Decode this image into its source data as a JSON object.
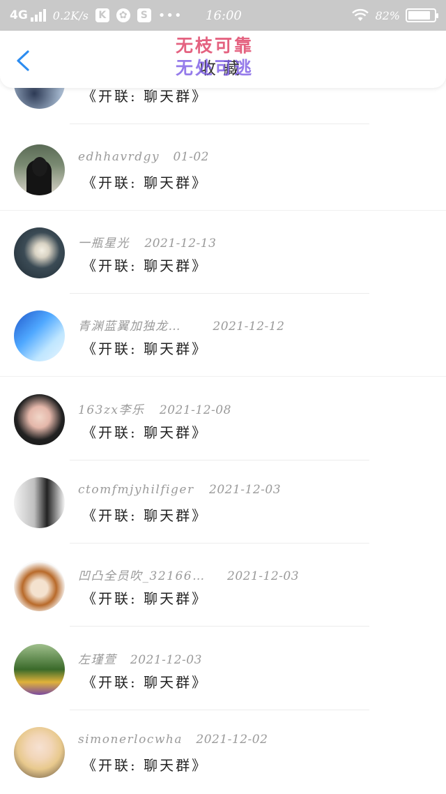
{
  "status_bar": {
    "network": "4G",
    "speed": "0.2K/s",
    "app_icon_1": "K",
    "app_icon_2": "S",
    "more": "•••",
    "time": "16:00",
    "battery_text": "82%",
    "battery_level": 0.82
  },
  "header": {
    "title": "收藏",
    "watermark_line1": "无枝可靠",
    "watermark_line2": "无处可逃"
  },
  "items": [
    {
      "name": "",
      "date": "",
      "message": "《开联: 聊天群》"
    },
    {
      "name": "edhhavrdgy",
      "date": "01-02",
      "message": "《开联: 聊天群》"
    },
    {
      "name": "一瓶星光",
      "date": "2021-12-13",
      "message": "《开联: 聊天群》"
    },
    {
      "name": "青渊蓝翼加独龙…",
      "date": "2021-12-12",
      "message": "《开联: 聊天群》"
    },
    {
      "name": "163zx李乐",
      "date": "2021-12-08",
      "message": "《开联: 聊天群》"
    },
    {
      "name": "ctomfmjyhilfiger",
      "date": "2021-12-03",
      "message": "《开联: 聊天群》"
    },
    {
      "name": "凹凸全员吹_32166…",
      "date": "2021-12-03",
      "message": "《开联: 聊天群》"
    },
    {
      "name": "左瑾萱",
      "date": "2021-12-03",
      "message": "《开联: 聊天群》"
    },
    {
      "name": "simonerlocwha",
      "date": "2021-12-02",
      "message": "《开联: 聊天群》"
    }
  ]
}
